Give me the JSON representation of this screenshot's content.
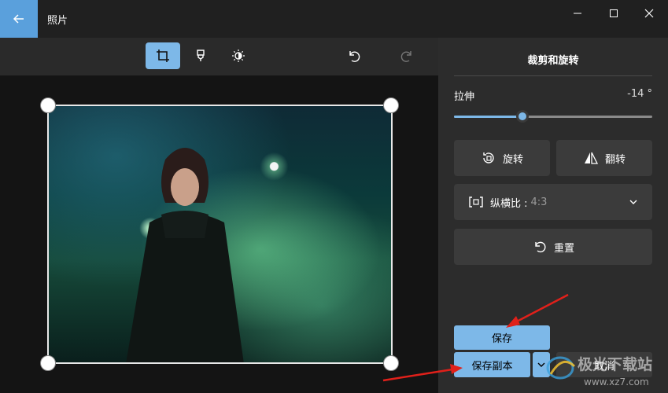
{
  "window": {
    "title": "照片",
    "back_icon": "back-arrow-icon",
    "controls": [
      "minimize-icon",
      "maximize-icon",
      "close-icon"
    ]
  },
  "toolbar": {
    "tools": [
      {
        "name": "crop-icon",
        "active": true
      },
      {
        "name": "markup-icon",
        "active": false
      },
      {
        "name": "adjust-icon",
        "active": false
      }
    ],
    "undo_icon": "undo-icon",
    "redo_icon": "redo-icon"
  },
  "panel": {
    "title": "裁剪和旋转",
    "straighten": {
      "label": "拉伸",
      "value_text": "-14 °",
      "value": -14,
      "min": -45,
      "max": 45
    },
    "rotate_label": "旋转",
    "flip_label": "翻转",
    "aspect": {
      "label": "纵横比 :",
      "value": "4:3"
    },
    "reset_label": "重置",
    "save_label": "保存",
    "save_copy_label": "保存副本",
    "cancel_label": "取消"
  },
  "watermark": {
    "text": "极光下载站",
    "url": "www.xz7.com"
  },
  "colors": {
    "accent": "#7db8e8",
    "annotation_arrow": "#e0201a",
    "panel_bg": "#2c2c2c"
  }
}
